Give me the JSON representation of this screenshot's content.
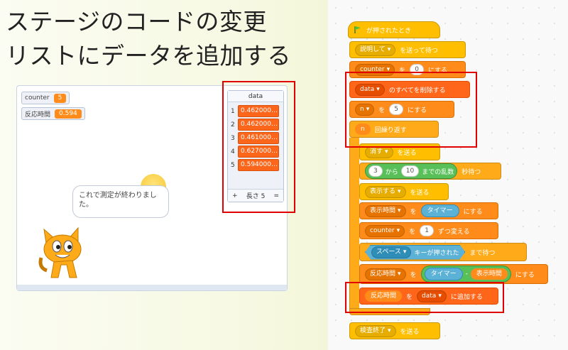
{
  "slide": {
    "title_line1": "ステージのコードの変更",
    "title_line2": "リストにデータを追加する"
  },
  "stage": {
    "monitors": [
      {
        "label": "counter",
        "value": "5"
      },
      {
        "label": "反応時間",
        "value": "0.594"
      }
    ],
    "list": {
      "name": "data",
      "items": [
        "0.462000…",
        "0.462000…",
        "0.461000…",
        "0.627000…",
        "0.594000…"
      ],
      "footer_add": "+",
      "footer_length": "長さ 5",
      "footer_resize": "="
    },
    "speech_bubble": "これで測定が終わりました。"
  },
  "script": {
    "hat": "が押されたとき",
    "broadcast_wait": {
      "msg": "説明して",
      "suffix": "を送って待つ"
    },
    "set_counter": {
      "var": "counter",
      "to": "を",
      "value": "0",
      "suffix": "にする"
    },
    "delete_all": {
      "list": "data",
      "suffix": "のすべてを削除する"
    },
    "set_n": {
      "var": "n",
      "to": "を",
      "value": "5",
      "suffix": "にする"
    },
    "repeat": {
      "var": "n",
      "suffix": "回繰り返す"
    },
    "broadcast_hide": {
      "msg": "消す",
      "suffix": "を送る"
    },
    "wait_random": {
      "from": "3",
      "from_lbl": "から",
      "to": "10",
      "to_lbl": "までの乱数",
      "suffix": "秒待つ"
    },
    "broadcast_show": {
      "msg": "表示する",
      "suffix": "を送る"
    },
    "set_show_time": {
      "var": "表示時間",
      "to": "を",
      "value": "タイマー",
      "suffix": "にする"
    },
    "change_counter": {
      "var": "counter",
      "to": "を",
      "value": "1",
      "suffix": "ずつ変える"
    },
    "wait_until": {
      "key": "スペース",
      "mid": "キーが押された",
      "suffix": "まで待つ"
    },
    "set_react": {
      "var": "反応時間",
      "to": "を",
      "a": "タイマー",
      "op": "-",
      "b": "表示時間",
      "suffix": "にする"
    },
    "add_to_list": {
      "item": "反応時間",
      "to": "を",
      "list": "data",
      "suffix": "に追加する"
    },
    "broadcast_end": {
      "msg": "検査終了",
      "suffix": "を送る"
    }
  },
  "colors": {
    "highlight": "#e10000",
    "events": "#ffbf00",
    "control": "#ffab19",
    "variables": "#ff8c1a",
    "lists": "#ff661a",
    "sensing": "#5cb1d6",
    "operators": "#59c059"
  }
}
